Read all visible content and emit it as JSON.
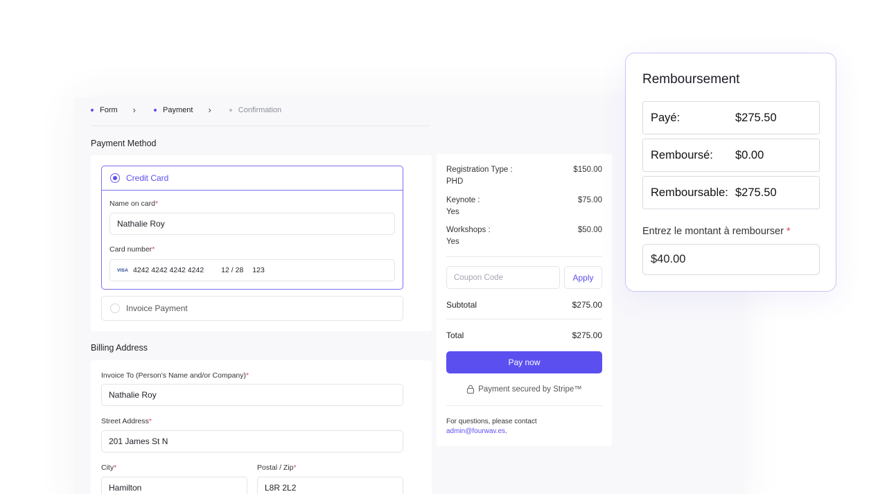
{
  "stepper": {
    "steps": [
      {
        "label": "Form"
      },
      {
        "label": "Payment"
      },
      {
        "label": "Confirmation"
      }
    ]
  },
  "payment_method": {
    "title": "Payment Method",
    "credit_card_label": "Credit Card",
    "name_on_card_label": "Name on card",
    "name_on_card_value": "Nathalie Roy",
    "card_number_label": "Card number",
    "card_brand": "VISA",
    "card_number_value": "4242 4242 4242 4242",
    "card_expiry_value": "12 / 28",
    "card_cvc_value": "123",
    "invoice_payment_label": "Invoice Payment"
  },
  "billing": {
    "title": "Billing Address",
    "invoice_to_label": "Invoice To (Person's Name and/or Company)",
    "invoice_to_value": "Nathalie Roy",
    "street_label": "Street Address",
    "street_value": "201 James St N",
    "city_label": "City",
    "city_value": "Hamilton",
    "postal_label": "Postal / Zip",
    "postal_value": "L8R 2L2"
  },
  "summary": {
    "items": [
      {
        "key": "Registration Type :",
        "sub": "PHD",
        "price": "$150.00"
      },
      {
        "key": "Keynote :",
        "sub": "Yes",
        "price": "$75.00"
      },
      {
        "key": "Workshops :",
        "sub": "Yes",
        "price": "$50.00"
      }
    ],
    "coupon_placeholder": "Coupon Code",
    "apply_label": "Apply",
    "subtotal_label": "Subtotal",
    "subtotal_value": "$275.00",
    "total_label": "Total",
    "total_value": "$275.00",
    "pay_label": "Pay now",
    "secured_label": "Payment secured by Stripe™",
    "help_text": "For questions, please contact",
    "help_email": "admin@fourwav.es",
    "help_period": "."
  },
  "refund": {
    "title": "Remboursement",
    "paid_label": "Payé:",
    "paid_value": "$275.50",
    "refunded_label": "Remboursé:",
    "refunded_value": "$0.00",
    "refundable_label": "Remboursable:",
    "refundable_value": "$275.50",
    "amount_label": "Entrez le montant à rembourser",
    "required_mark": "*",
    "amount_value": "$40.00"
  },
  "colors": {
    "accent": "#5b4ff0",
    "required": "#e0455a"
  }
}
